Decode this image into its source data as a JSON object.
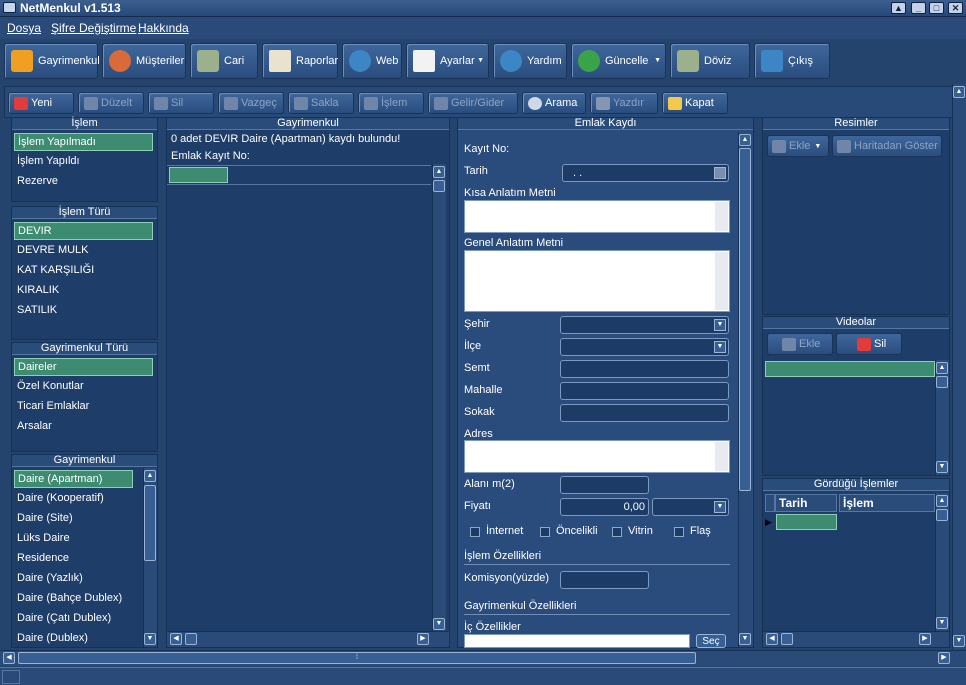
{
  "window": {
    "title": "NetMenkul v1.513"
  },
  "menu": [
    "Dosya",
    "Şifre Değiştirme",
    "Hakkında"
  ],
  "toolbar": [
    "Gayrimenkul",
    "Müşteriler",
    "Cari",
    "Raporlar",
    "Web",
    "Ayarlar",
    "Yardım",
    "Güncelle",
    "Döviz",
    "Çıkış"
  ],
  "subtoolbar": [
    "Yeni",
    "Düzelt",
    "Sil",
    "Vazgeç",
    "Sakla",
    "İşlem",
    "Gelir/Gider",
    "Arama",
    "Yazdır",
    "Kapat"
  ],
  "islem": {
    "title": "İşlem",
    "items": [
      "İşlem Yapılmadı",
      "İşlem Yapıldı",
      "Rezerve"
    ]
  },
  "islem_turu": {
    "title": "İşlem Türü",
    "items": [
      "DEVIR",
      "DEVRE MULK",
      "KAT KARŞILIĞI",
      "KIRALIK",
      "SATILIK"
    ]
  },
  "gayrimenkul_turu": {
    "title": "Gayrimenkul Türü",
    "items": [
      "Daireler",
      "Özel Konutlar",
      "Ticari Emlaklar",
      "Arsalar"
    ]
  },
  "gayrimenkul_list": {
    "title": "Gayrimenkul",
    "items": [
      "Daire (Apartman)",
      "Daire (Kooperatif)",
      "Daire (Site)",
      "Lüks Daire",
      "Residence",
      "Daire (Yazlık)",
      "Daire (Bahçe Dublex)",
      "Daire (Çatı Dublex)",
      "Daire (Dublex)"
    ]
  },
  "middle": {
    "title": "Gayrimenkul",
    "status": "0 adet DEVIR Daire (Apartman) kaydı bulundu!",
    "kayit_label": "Emlak Kayıt No:"
  },
  "form": {
    "title": "Emlak Kaydı",
    "kayit_no": "Kayıt No:",
    "tarih": "Tarih",
    "tarih_value": ". .",
    "kisa": "Kısa Anlatım Metni",
    "genel": "Genel Anlatım Metni",
    "sehir": "Şehir",
    "ilce": "İlçe",
    "semt": "Semt",
    "mahalle": "Mahalle",
    "sokak": "Sokak",
    "adres": "Adres",
    "alan": "Alanı m(2)",
    "fiyat": "Fiyatı",
    "fiyat_value": "0,00",
    "checks": [
      "İnternet",
      "Öncelikli",
      "Vitrin",
      "Flaş"
    ],
    "islem_ozellikleri": "İşlem Özellikleri",
    "komisyon": "Komisyon(yüzde)",
    "gayrimenkul_ozellikleri": "Gayrimenkul Özellikleri",
    "ic_ozellikler": "İç Özellikler",
    "sec": "Seç"
  },
  "resimler": {
    "title": "Resimler",
    "ekle": "Ekle",
    "harita": "Haritadan Göster"
  },
  "videolar": {
    "title": "Videolar",
    "ekle": "Ekle",
    "sil": "Sil"
  },
  "gordugu": {
    "title": "Gördüğü İşlemler",
    "cols": [
      "Tarih",
      "İşlem"
    ]
  }
}
